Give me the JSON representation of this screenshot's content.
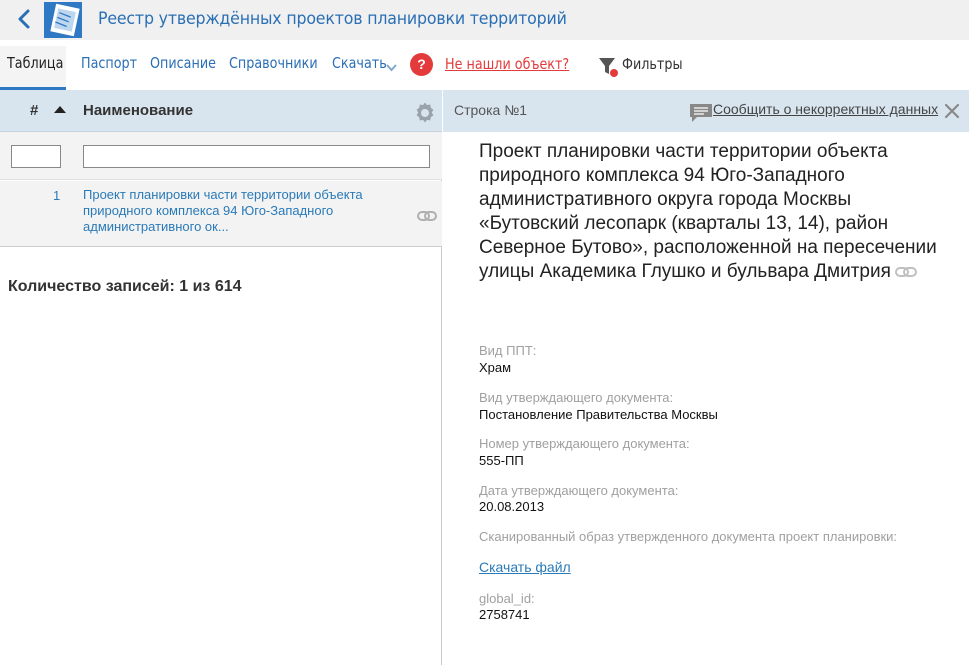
{
  "header": {
    "title": "Реестр утверждённых проектов планировки территорий"
  },
  "nav": {
    "table": "Таблица",
    "passport": "Паспорт",
    "description": "Описание",
    "references": "Справочники",
    "download": "Скачать",
    "help": "?",
    "not_found": "Не нашли объект?",
    "filters": "Фильтры"
  },
  "table": {
    "col_num": "#",
    "col_name": "Наименование",
    "rows": [
      {
        "num": "1",
        "name": "Проект планировки части территории объекта природного комплекса 94 Юго-Западного административного ок..."
      }
    ],
    "count_label": "Количество записей: 1 из 614"
  },
  "detail": {
    "row_label": "Строка №1",
    "report_link": "Сообщить о некорректных данных",
    "title": "Проект планировки части территории объекта природного комплекса 94 Юго-Западного административного округа города Москвы «Бутовский лесопарк (кварталы 13, 14), район Северное Бутово», расположенной на пересечении улицы Академика Глушко и бульвара Дмитрия",
    "fields": [
      {
        "label": "Вид ППТ:",
        "value": "Храм"
      },
      {
        "label": "Вид утверждающего документа:",
        "value": "Постановление Правительства Москвы"
      },
      {
        "label": "Номер утверждающего документа:",
        "value": "555-ПП"
      },
      {
        "label": "Дата утверждающего документа:",
        "value": "20.08.2013"
      },
      {
        "label": "Сканированный образ утвержденного документа проект планировки:",
        "value": ""
      },
      {
        "label": "global_id:",
        "value": "2758741"
      }
    ],
    "download_file": "Скачать файл"
  },
  "colors": {
    "accent": "#2f78c4",
    "link": "#2a7ab8",
    "danger": "#e33b3b",
    "header_bg": "#d9e5ee"
  },
  "icons": [
    "back-icon",
    "app-logo-icon",
    "chevron-down-icon",
    "help-icon",
    "filter-icon",
    "sort-asc-icon",
    "gear-icon",
    "link-icon",
    "comment-icon",
    "close-icon"
  ]
}
